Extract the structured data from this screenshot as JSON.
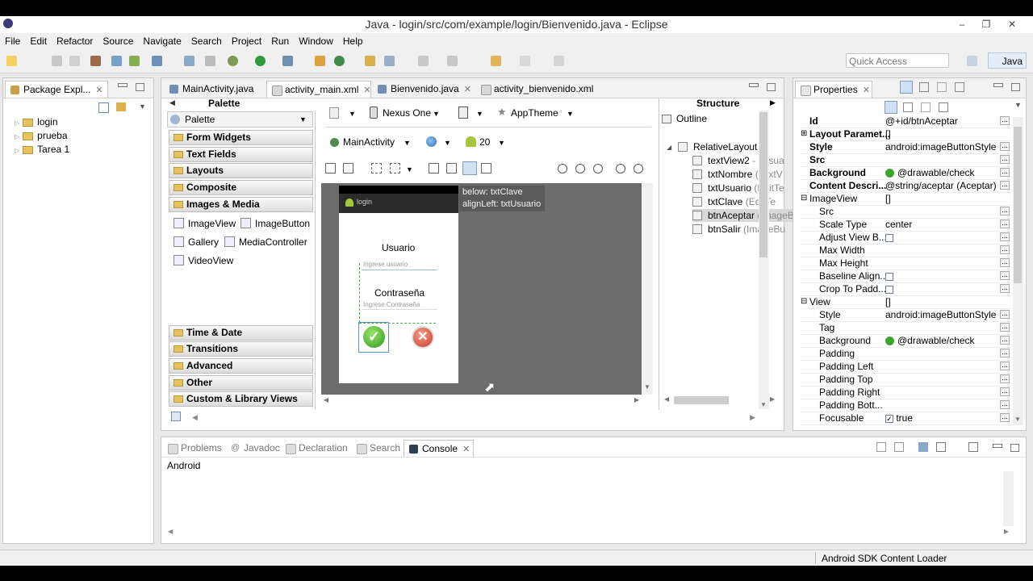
{
  "window": {
    "title": "Java - login/src/com/example/login/Bienvenido.java - Eclipse"
  },
  "menu": [
    "File",
    "Edit",
    "Refactor",
    "Source",
    "Navigate",
    "Search",
    "Project",
    "Run",
    "Window",
    "Help"
  ],
  "toolbar": {
    "quick_access_placeholder": "Quick Access",
    "perspective": "Java"
  },
  "package_explorer": {
    "tab": "Package Expl...",
    "projects": [
      "login",
      "prueba",
      "Tarea 1"
    ]
  },
  "editor_tabs": [
    "MainActivity.java",
    "activity_main.xml",
    "Bienvenido.java",
    "activity_bienvenido.xml"
  ],
  "palette": {
    "title": "Palette",
    "dropdown": "Palette",
    "drawers_top": [
      "Form Widgets",
      "Text Fields",
      "Layouts",
      "Composite",
      "Images & Media"
    ],
    "items": [
      "ImageView",
      "ImageButton",
      "Gallery",
      "MediaController",
      "VideoView"
    ],
    "drawers_bottom": [
      "Time & Date",
      "Transitions",
      "Advanced",
      "Other",
      "Custom & Library Views"
    ]
  },
  "layout_toolbar": {
    "device": "Nexus One",
    "theme": "AppTheme",
    "activity": "MainActivity",
    "api": "20"
  },
  "device_preview": {
    "app_title": "login",
    "label_user": "Usuario",
    "hint_user": "Ingrese usuario",
    "label_pass": "Contraseña",
    "hint_pass": "Ingrese Contraseña",
    "tooltip_line1": "below: txtClave",
    "tooltip_line2": "alignLeft: txtUsuario"
  },
  "structure": {
    "title": "Structure",
    "outline": "Outline",
    "root": "RelativeLayout",
    "children": [
      {
        "name": "textView2",
        "hint": "- \"Usua"
      },
      {
        "name": "txtNombre",
        "hint": "(TextV"
      },
      {
        "name": "txtUsuario",
        "hint": "(EditTe"
      },
      {
        "name": "txtClave",
        "hint": "(EditTe"
      },
      {
        "name": "btnAceptar",
        "hint": "(ImageB"
      },
      {
        "name": "btnSalir",
        "hint": "(ImageBu"
      }
    ]
  },
  "properties": {
    "tab": "Properties",
    "rows": [
      {
        "key": "Id",
        "value": "@+id/btnAceptar",
        "bold": true
      },
      {
        "key": "Layout Paramet...",
        "value": "[]",
        "bold": true
      },
      {
        "key": "Style",
        "value": "android:imageButtonStyle",
        "bold": true
      },
      {
        "key": "Src",
        "value": "",
        "bold": true
      },
      {
        "key": "Background",
        "value": "@drawable/check",
        "bold": true
      },
      {
        "key": "Content Descri...",
        "value": "@string/aceptar (Aceptar)",
        "bold": true
      },
      {
        "key": "ImageView",
        "value": "[]",
        "bold": false
      },
      {
        "key": "Src",
        "value": "",
        "bold": false
      },
      {
        "key": "Scale Type",
        "value": "center",
        "bold": false
      },
      {
        "key": "Adjust View B...",
        "value": "",
        "bold": false
      },
      {
        "key": "Max Width",
        "value": "",
        "bold": false
      },
      {
        "key": "Max Height",
        "value": "",
        "bold": false
      },
      {
        "key": "Baseline Align...",
        "value": "",
        "bold": false
      },
      {
        "key": "Crop To Padd...",
        "value": "",
        "bold": false
      },
      {
        "key": "View",
        "value": "[]",
        "bold": false
      },
      {
        "key": "Style",
        "value": "android:imageButtonStyle",
        "bold": false
      },
      {
        "key": "Tag",
        "value": "",
        "bold": false
      },
      {
        "key": "Background",
        "value": "@drawable/check",
        "bold": false
      },
      {
        "key": "Padding",
        "value": "",
        "bold": false
      },
      {
        "key": "Padding Left",
        "value": "",
        "bold": false
      },
      {
        "key": "Padding Top",
        "value": "",
        "bold": false
      },
      {
        "key": "Padding Right",
        "value": "",
        "bold": false
      },
      {
        "key": "Padding Bott...",
        "value": "",
        "bold": false
      },
      {
        "key": "Focusable",
        "value": "true",
        "bold": false
      }
    ]
  },
  "bottom_tabs": [
    "Problems",
    "Javadoc",
    "Declaration",
    "Search",
    "Console"
  ],
  "console": {
    "text": "Android"
  },
  "statusbar": {
    "text": "Android SDK Content Loader"
  },
  "colors": {
    "accent": "#2f5f9e",
    "canvas": "#6c6c6c",
    "android_green": "#a4c639"
  }
}
